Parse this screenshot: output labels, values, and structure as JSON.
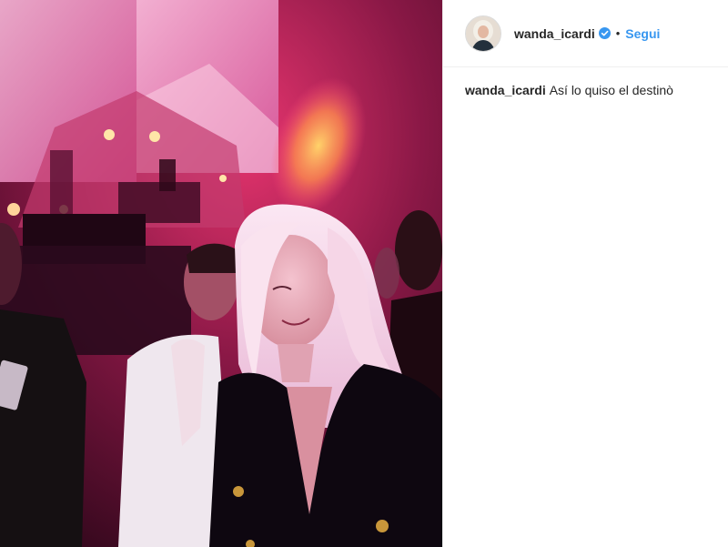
{
  "post": {
    "username": "wanda_icardi",
    "verified_icon": "verified-badge-icon",
    "separator": "•",
    "follow_label": "Segui",
    "caption_user": "wanda_icardi",
    "caption_text": "Así lo quiso el destinò",
    "accent_color": "#3897f0"
  },
  "photo": {
    "description_icon": "post-photo"
  }
}
